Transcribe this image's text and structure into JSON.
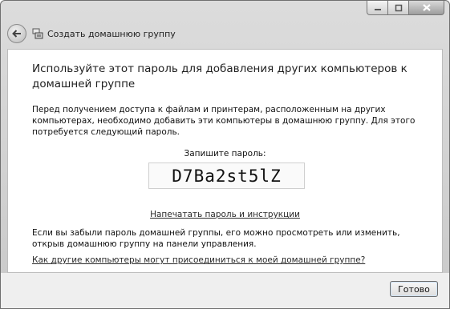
{
  "window": {
    "title": "Создать домашнюю группу"
  },
  "content": {
    "heading": "Используйте этот пароль для добавления других компьютеров к домашней группе",
    "intro": "Перед получением доступа к файлам и принтерам, расположенным на других компьютерах, необходимо добавить эти компьютеры в домашнюю группу. Для этого потребуется следующий пароль.",
    "password_label": "Запишите пароль:",
    "password": "D7Ba2st5lZ",
    "print_link": "Напечатать пароль и инструкции",
    "forgot_text": "Если вы забыли пароль домашней группы, его можно просмотреть или изменить, открыв домашнюю группу на панели управления.",
    "how_link": "Как другие компьютеры могут присоединиться к моей домашней группе?"
  },
  "footer": {
    "done_label": "Готово"
  },
  "icons": {
    "back": "back-arrow-icon",
    "homegroup": "homegroup-icon",
    "minimize": "minimize-icon",
    "maximize": "maximize-icon",
    "close": "close-icon"
  }
}
